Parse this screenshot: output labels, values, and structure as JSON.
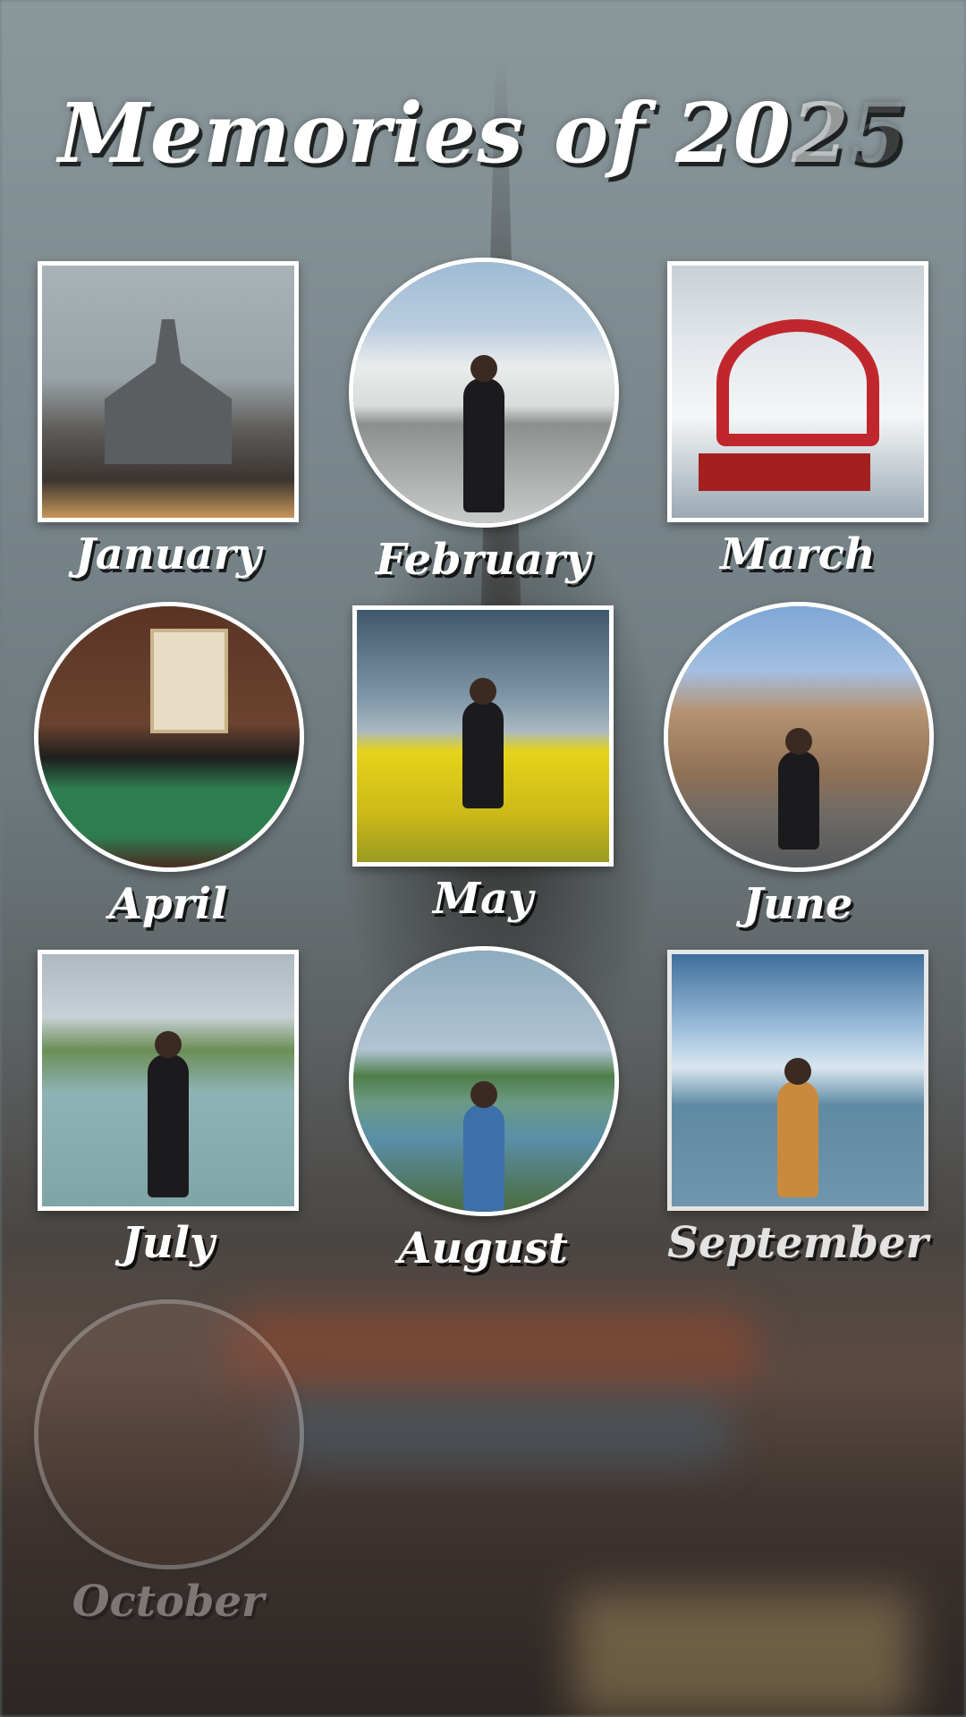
{
  "title": {
    "main": "Memories of 20",
    "faded": "2",
    "ghost": "5"
  },
  "months": [
    {
      "label": "January",
      "shape": "square",
      "palette": [
        "#9fa8ad",
        "#6c6f70",
        "#3a3633",
        "#c18a55"
      ]
    },
    {
      "label": "February",
      "shape": "circle",
      "palette": [
        "#a8c6dc",
        "#eef1f2",
        "#8e918f",
        "#1d1d1f"
      ]
    },
    {
      "label": "March",
      "shape": "square",
      "palette": [
        "#cfd7de",
        "#f2f4f6",
        "#c0272d",
        "#6b7b8a"
      ]
    },
    {
      "label": "April",
      "shape": "circle",
      "palette": [
        "#5a3424",
        "#2e7d4f",
        "#1f1f1f",
        "#d8c7a4"
      ]
    },
    {
      "label": "May",
      "shape": "square",
      "palette": [
        "#4b6478",
        "#9fb3c2",
        "#e7d21c",
        "#3d5a2e"
      ]
    },
    {
      "label": "June",
      "shape": "circle",
      "palette": [
        "#7ea7d6",
        "#b69474",
        "#6f6a66",
        "#2a2a2c"
      ]
    },
    {
      "label": "July",
      "shape": "square",
      "palette": [
        "#b7c3cc",
        "#5f8a4a",
        "#8fb2b5",
        "#111111"
      ]
    },
    {
      "label": "August",
      "shape": "circle",
      "palette": [
        "#9db4c4",
        "#4f7d4a",
        "#5a8fa8",
        "#c0392b"
      ]
    },
    {
      "label": "September",
      "shape": "square",
      "palette": [
        "#5b89b4",
        "#cfe0ee",
        "#5f8aa3",
        "#c98a3e"
      ]
    },
    {
      "label": "October",
      "shape": "circle",
      "palette": [
        "#6a4a42",
        "#7e5d52",
        "#5c4038",
        "#8a3a32"
      ]
    }
  ]
}
